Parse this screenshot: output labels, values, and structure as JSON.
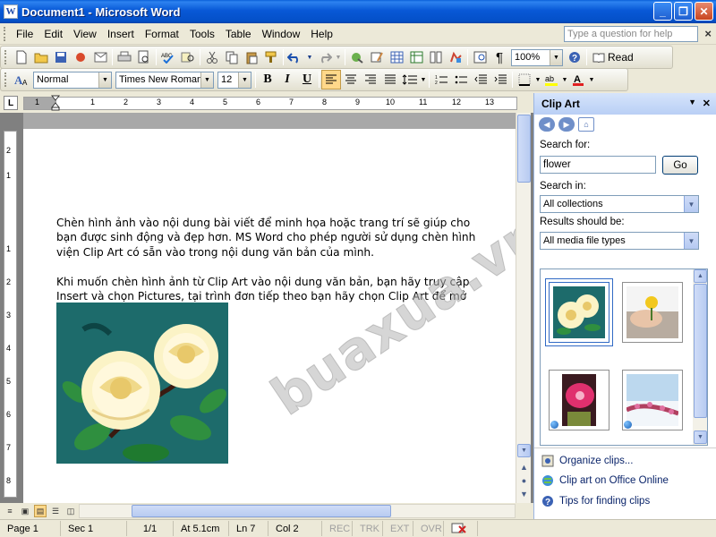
{
  "window": {
    "title": "Document1 - Microsoft Word",
    "icon_letter": "W",
    "minimize": "_",
    "maximize": "❐",
    "close": "✕"
  },
  "menu": {
    "items": [
      "File",
      "Edit",
      "View",
      "Insert",
      "Format",
      "Tools",
      "Table",
      "Window",
      "Help"
    ],
    "help_placeholder": "Type a question for help",
    "close": "×"
  },
  "standard_toolbar": {
    "zoom": "100%",
    "read_label": "Read"
  },
  "formatting_toolbar": {
    "style": "Normal",
    "font": "Times New Roman",
    "size": "12",
    "bold": "B",
    "italic": "I",
    "underline": "U"
  },
  "ruler": {
    "numbers": [
      "1",
      "1",
      "2",
      "3",
      "4",
      "5",
      "6",
      "7",
      "8",
      "9",
      "10",
      "11",
      "12",
      "13"
    ],
    "vertical_numbers": [
      "2",
      "1",
      "1",
      "2",
      "3",
      "4",
      "5",
      "6",
      "7",
      "8"
    ]
  },
  "document": {
    "paragraph1": [
      "Chèn hình ảnh vào nội dung bài viết để minh họa hoặc trang trí sẽ giúp cho",
      "bạn được sinh động và đẹp hơn. MS Word cho phép người sử dụng chèn hình",
      "viện Clip Art có sẵn vào trong nội dung văn bản của mình."
    ],
    "paragraph2": [
      "Khi muốn chèn hình ảnh từ Clip Art vào nội dung văn bản, bạn hãy truy cập",
      "Insert và chọn Pictures, tại trình đơn tiếp theo bạn hãy chọn Clip Art để mở"
    ],
    "watermark": "buaxua.vn"
  },
  "status": {
    "page": "Page 1",
    "sec": "Sec 1",
    "of": "1/1",
    "at": "At 5.1cm",
    "ln": "Ln 7",
    "col": "Col 2",
    "rec": "REC",
    "trk": "TRK",
    "ext": "EXT",
    "ovr": "OVR"
  },
  "clip_art_pane": {
    "title": "Clip Art",
    "search_for_label": "Search for:",
    "search_value": "flower",
    "go_label": "Go",
    "search_in_label": "Search in:",
    "search_in_value": "All collections",
    "results_label": "Results should be:",
    "results_value": "All media file types",
    "links": [
      "Organize clips...",
      "Clip art on Office Online",
      "Tips for finding clips"
    ]
  },
  "colors": {
    "title_bar": "#0858d6",
    "pane_header": "#c6d9f8",
    "rose_bg": "#1d6b6b"
  }
}
